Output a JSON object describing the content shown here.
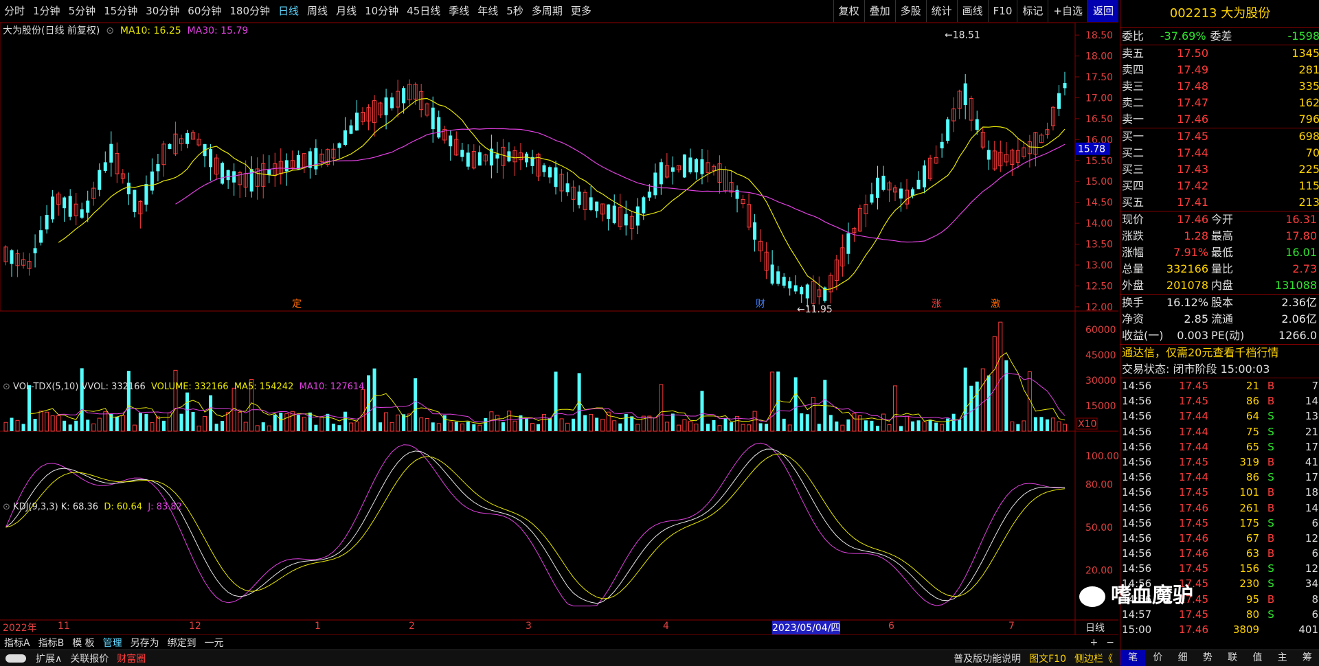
{
  "periods": [
    "分时",
    "1分钟",
    "5分钟",
    "15分钟",
    "30分钟",
    "60分钟",
    "180分钟",
    "日线",
    "周线",
    "月线",
    "10分钟",
    "45日线",
    "季线",
    "年线",
    "5秒",
    "多周期",
    "更多"
  ],
  "active_period": "日线",
  "tools": [
    "复权",
    "叠加",
    "多股",
    "统计",
    "画线",
    "F10",
    "标记",
    "+自选",
    "返回"
  ],
  "main": {
    "title": "大为股份(日线 前复权)",
    "ma10_label": "MA10: 16.25",
    "ma30_label": "MA30: 15.79",
    "y_ticks": [
      "18.50",
      "18.00",
      "17.50",
      "17.00",
      "16.50",
      "16.00",
      "15.50",
      "15.00",
      "14.50",
      "14.00",
      "13.50",
      "13.00",
      "12.50",
      "12.00"
    ],
    "price_tag": "15.78",
    "high_label": "18.51",
    "low_label": "11.95",
    "markers": [
      "定",
      "财",
      "涨",
      "激"
    ]
  },
  "vol": {
    "title": "VOL-TDX(5,10)",
    "vvol": "VVOL: 332166",
    "volume": "VOLUME: 332166",
    "ma5": "MA5: 154242",
    "ma10": "MA10: 127614",
    "y_ticks": [
      "60000",
      "45000",
      "30000",
      "15000"
    ],
    "unit": "X10"
  },
  "kdj": {
    "title": "KDJ(9,3,3)",
    "k": "K: 68.36",
    "d": "D: 60.64",
    "j": "J: 83.82",
    "y_ticks": [
      "100.00",
      "80.00",
      "50.00",
      "20.00"
    ]
  },
  "x_ticks": [
    "2022年",
    "11",
    "12",
    "1",
    "2",
    "3",
    "4",
    "2023/05/04/四",
    "6",
    "7"
  ],
  "period_label": "日线",
  "stock": {
    "code": "002213",
    "name": "大为股份"
  },
  "weibi": {
    "label1": "委比",
    "value1": "-37.69%",
    "label2": "委差",
    "value2": "-1598"
  },
  "asks": [
    {
      "label": "卖五",
      "price": "17.50",
      "vol": "1345"
    },
    {
      "label": "卖四",
      "price": "17.49",
      "vol": "281"
    },
    {
      "label": "卖三",
      "price": "17.48",
      "vol": "335"
    },
    {
      "label": "卖二",
      "price": "17.47",
      "vol": "162"
    },
    {
      "label": "卖一",
      "price": "17.46",
      "vol": "796"
    }
  ],
  "bids": [
    {
      "label": "买一",
      "price": "17.45",
      "vol": "698"
    },
    {
      "label": "买二",
      "price": "17.44",
      "vol": "70"
    },
    {
      "label": "买三",
      "price": "17.43",
      "vol": "225"
    },
    {
      "label": "买四",
      "price": "17.42",
      "vol": "115"
    },
    {
      "label": "买五",
      "price": "17.41",
      "vol": "213"
    }
  ],
  "stats1": [
    {
      "l1": "现价",
      "v1": "17.46",
      "l2": "今开",
      "v2": "16.31"
    },
    {
      "l1": "涨跌",
      "v1": "1.28",
      "l2": "最高",
      "v2": "17.80"
    },
    {
      "l1": "涨幅",
      "v1": "7.91%",
      "l2": "最低",
      "v2": "16.01"
    },
    {
      "l1": "总量",
      "v1": "332166",
      "l2": "量比",
      "v2": "2.73"
    },
    {
      "l1": "外盘",
      "v1": "201078",
      "l2": "内盘",
      "v2": "131088"
    }
  ],
  "stats2": [
    {
      "l1": "换手",
      "v1": "16.12%",
      "l2": "股本",
      "v2": "2.36亿"
    },
    {
      "l1": "净资",
      "v1": "2.85",
      "l2": "流通",
      "v2": "2.06亿"
    },
    {
      "l1": "收益(一)",
      "v1": "0.003",
      "l2": "PE(动)",
      "v2": "1266.0"
    }
  ],
  "promo": "通达信，仅需20元查看千档行情",
  "trade_status": "交易状态: 闭市阶段 15:00:03",
  "ticks": [
    {
      "t": "14:56",
      "p": "17.45",
      "v": "21",
      "s": "B",
      "n": "7"
    },
    {
      "t": "14:56",
      "p": "17.45",
      "v": "86",
      "s": "B",
      "n": "14"
    },
    {
      "t": "14:56",
      "p": "17.44",
      "v": "64",
      "s": "S",
      "n": "13"
    },
    {
      "t": "14:56",
      "p": "17.44",
      "v": "75",
      "s": "S",
      "n": "21"
    },
    {
      "t": "14:56",
      "p": "17.44",
      "v": "65",
      "s": "S",
      "n": "17"
    },
    {
      "t": "14:56",
      "p": "17.45",
      "v": "319",
      "s": "B",
      "n": "41"
    },
    {
      "t": "14:56",
      "p": "17.44",
      "v": "86",
      "s": "S",
      "n": "17"
    },
    {
      "t": "14:56",
      "p": "17.45",
      "v": "101",
      "s": "B",
      "n": "18"
    },
    {
      "t": "14:56",
      "p": "17.46",
      "v": "261",
      "s": "B",
      "n": "14"
    },
    {
      "t": "14:56",
      "p": "17.45",
      "v": "175",
      "s": "S",
      "n": "6"
    },
    {
      "t": "14:56",
      "p": "17.46",
      "v": "67",
      "s": "B",
      "n": "12"
    },
    {
      "t": "14:56",
      "p": "17.46",
      "v": "63",
      "s": "B",
      "n": "6"
    },
    {
      "t": "14:56",
      "p": "17.45",
      "v": "156",
      "s": "S",
      "n": "12"
    },
    {
      "t": "14:56",
      "p": "17.45",
      "v": "230",
      "s": "S",
      "n": "34"
    },
    {
      "t": "14:56",
      "p": "17.45",
      "v": "95",
      "s": "B",
      "n": "8"
    },
    {
      "t": "14:57",
      "p": "17.45",
      "v": "80",
      "s": "S",
      "n": "6"
    },
    {
      "t": "15:00",
      "p": "17.46",
      "v": "3809",
      "s": "",
      "n": "401"
    }
  ],
  "bottom1": [
    "指标A",
    "指标B",
    "模 板",
    "管理",
    "另存为",
    "绑定到",
    "一元"
  ],
  "bottom2": [
    "扩展∧",
    "关联报价",
    "财富圈"
  ],
  "bottom2_right": [
    "普及版功能说明",
    "图文F10",
    "侧边栏《"
  ],
  "side_tabs": [
    "笔",
    "价",
    "细",
    "势",
    "联",
    "值",
    "主",
    "筹"
  ],
  "watermark": "嗜血魔驴",
  "colors": {
    "up": "#ff3c3c",
    "down": "#54ffff",
    "ma10": "#e8e800",
    "ma30": "#e040e0"
  }
}
